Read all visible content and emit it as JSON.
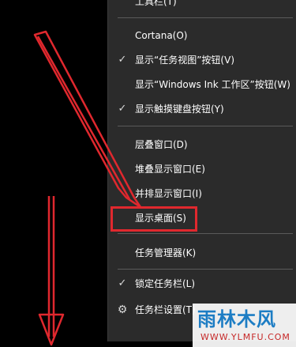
{
  "context_menu": {
    "items": [
      {
        "label": "工具栏(T)",
        "checked": false
      },
      {
        "label": "Cortana(O)",
        "checked": false
      },
      {
        "label": "显示“任务视图”按钮(V)",
        "checked": true
      },
      {
        "label": "显示“Windows Ink 工作区”按钮(W)",
        "checked": false
      },
      {
        "label": "显示触摸键盘按钮(Y)",
        "checked": true
      },
      {
        "label": "层叠窗口(D)",
        "checked": false
      },
      {
        "label": "堆叠显示窗口(E)",
        "checked": false
      },
      {
        "label": "并排显示窗口(I)",
        "checked": false
      },
      {
        "label": "显示桌面(S)",
        "checked": false,
        "highlighted": true
      },
      {
        "label": "任务管理器(K)",
        "checked": false
      },
      {
        "label": "锁定任务栏(L)",
        "checked": true
      },
      {
        "label": "任务栏设置(T)",
        "checked": false
      }
    ],
    "check_glyph": "✓",
    "gear_glyph": "⚙"
  },
  "annotation": {
    "color": "#e0282e"
  },
  "watermark": {
    "main": "雨林木风",
    "sub": "WWW.YLMFU.COM"
  }
}
